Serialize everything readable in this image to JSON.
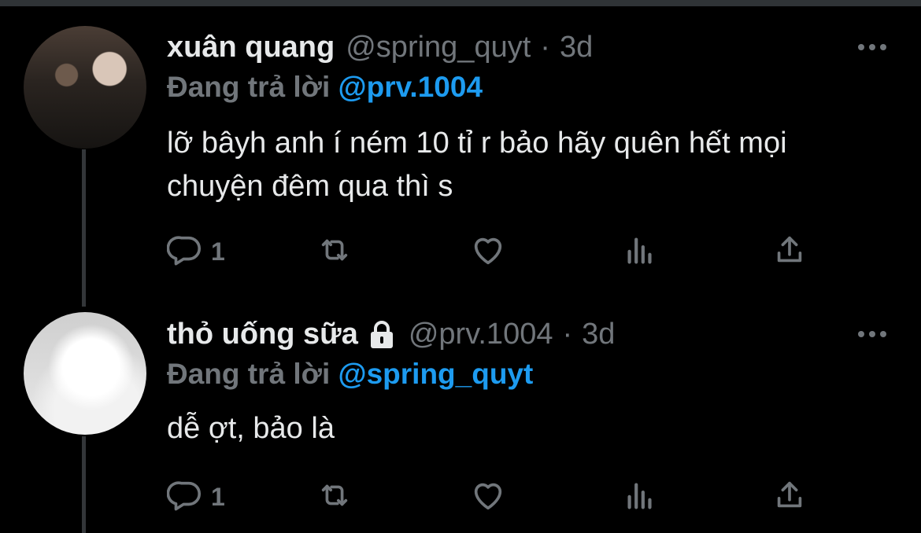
{
  "tweets": [
    {
      "name": "xuân quang",
      "handle": "@spring_quyt",
      "separator": "·",
      "time": "3d",
      "locked": false,
      "reply_prefix": "Đang trả lời",
      "reply_to": "@prv.1004",
      "text": "lỡ bâyh anh í ném 10 tỉ r bảo hãy quên hết mọi chuyện đêm qua thì s",
      "reply_count": "1"
    },
    {
      "name": "thỏ uống sữa",
      "handle": "@prv.1004",
      "separator": "·",
      "time": "3d",
      "locked": true,
      "reply_prefix": "Đang trả lời",
      "reply_to": "@spring_quyt",
      "text": "dễ ợt, bảo là",
      "reply_count": "1"
    }
  ],
  "icons": {
    "more": "more-horizontal-icon",
    "reply": "reply-icon",
    "retweet": "retweet-icon",
    "like": "heart-icon",
    "views": "views-icon",
    "share": "share-icon",
    "lock": "lock-icon"
  },
  "colors": {
    "background": "#000000",
    "text": "#e7e9ea",
    "secondary": "#71767b",
    "accent": "#1d9bf0"
  }
}
